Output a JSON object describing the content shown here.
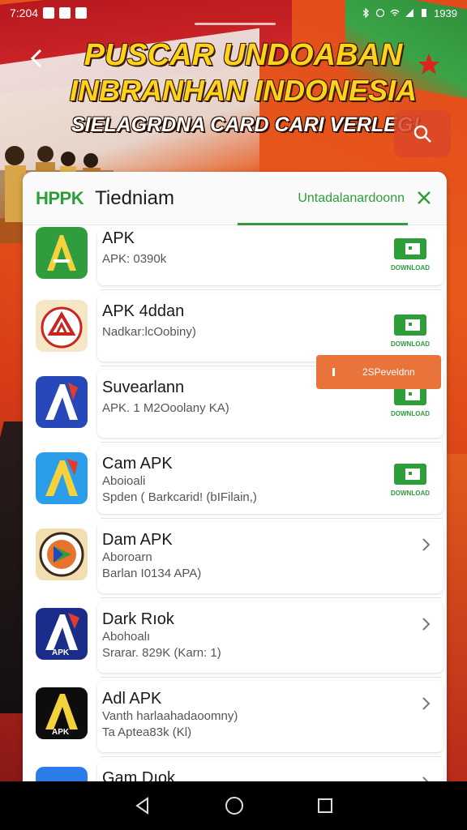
{
  "status_bar": {
    "time": "7:204",
    "right_text": "1939"
  },
  "header": {
    "headline_line1": "PUSCAR UNDOABAN",
    "headline_line2": "INBRANHAN INDONESIA",
    "headline_line3": "SIELAGRDNA CARD CARI VERLEG!"
  },
  "panel": {
    "logo": "HPPK",
    "title": "Tiedniam",
    "active_tab": "Untadalanardoonn"
  },
  "toast": {
    "label": "2SPeveldnn"
  },
  "download_label": "DOWNLOAD",
  "apps": [
    {
      "title": "APK",
      "sub": "APK: 0390k",
      "sub2": "",
      "icon": "green-a-icon",
      "action": "download"
    },
    {
      "title": "APK 4ddan",
      "sub": "Nadkar:lcOobiny)",
      "sub2": "",
      "icon": "red-triangle-icon",
      "action": "download"
    },
    {
      "title": "Suvearlann",
      "sub": "APK. 1 M2Ooolany KA)",
      "sub2": "",
      "icon": "blue-a-icon",
      "action": "download"
    },
    {
      "title": "Cam APK",
      "sub": "Aboioali",
      "sub2": "Spden ( Barkcarid! (bIFilain,)",
      "icon": "lightblue-a-icon",
      "action": "download"
    },
    {
      "title": "Dam APK",
      "sub": "Aboroarn",
      "sub2": "Barlan I0134 APA)",
      "icon": "circle-badge-icon",
      "action": "chevron"
    },
    {
      "title": "Dark Rıok",
      "sub": "Abohoalı",
      "sub2": "Srarar. 829K (Karn: 1)",
      "icon": "navy-a-icon",
      "action": "chevron"
    },
    {
      "title": "Adl APK",
      "sub": "Vanth harlaahadaoomny)",
      "sub2": "Ta Aptea83k (Kl)",
      "icon": "black-a-icon",
      "action": "chevron"
    },
    {
      "title": "Gam Dıok",
      "sub": "",
      "sub2": "",
      "icon": "partial-icon",
      "action": "chevron"
    }
  ]
}
